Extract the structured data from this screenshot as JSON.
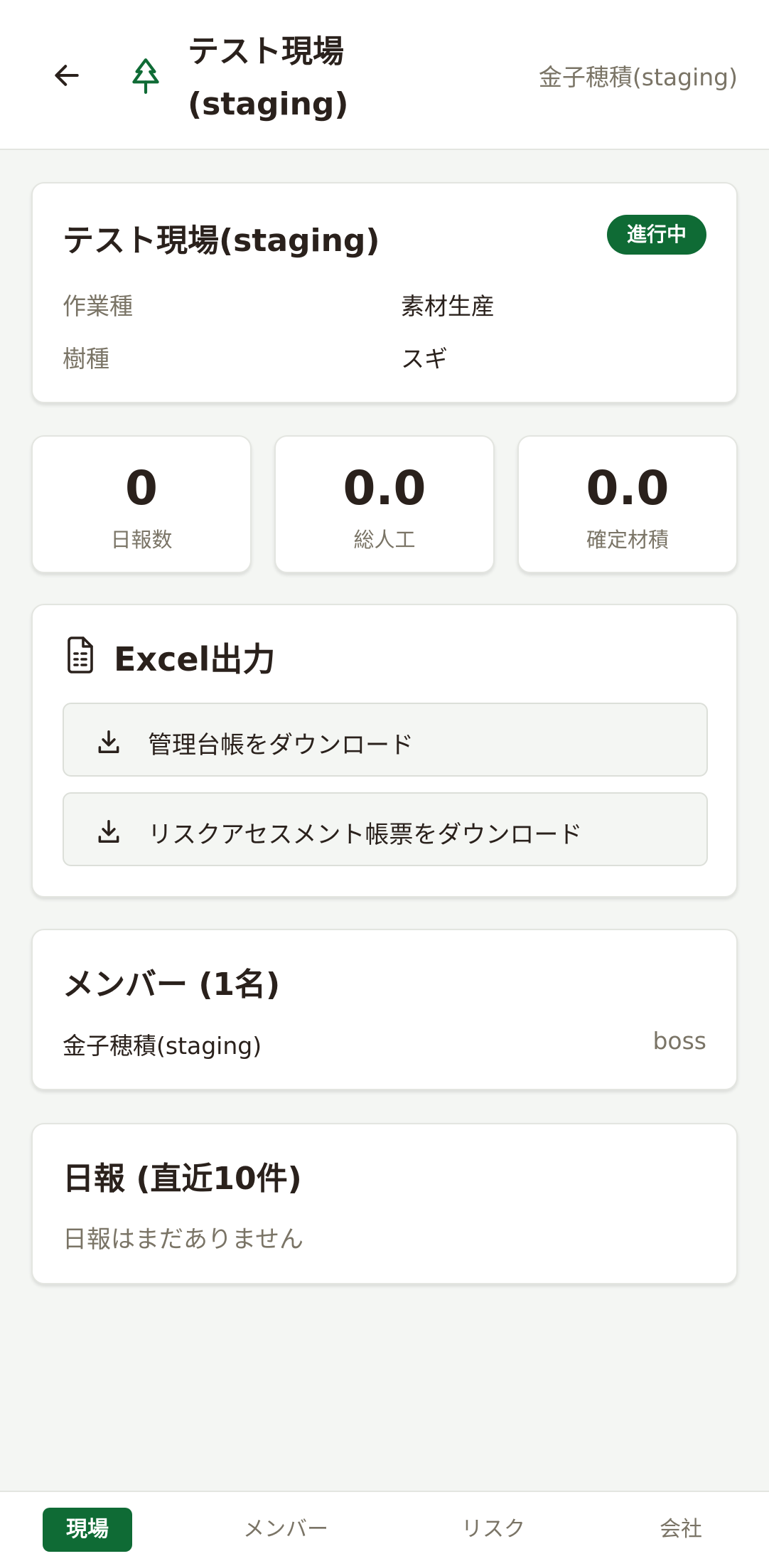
{
  "header": {
    "back_icon": "arrow-left-icon",
    "site_icon": "tree-icon",
    "title_line1": "テスト現場",
    "title_line2": "(staging)",
    "user_name": "金子穂積(staging)"
  },
  "site": {
    "name": "テスト現場(staging)",
    "status": "進行中",
    "status_color": "#0f6b35",
    "fields": [
      {
        "label": "作業種",
        "value": "素材生産"
      },
      {
        "label": "樹種",
        "value": "スギ"
      }
    ]
  },
  "stats": [
    {
      "value": "0",
      "label": "日報数"
    },
    {
      "value": "0.0",
      "label": "総人工"
    },
    {
      "value": "0.0",
      "label": "確定材積"
    }
  ],
  "excel": {
    "icon": "spreadsheet-file-icon",
    "title": "Excel出力",
    "buttons": [
      {
        "icon": "download-icon",
        "label": "管理台帳をダウンロード"
      },
      {
        "icon": "download-icon",
        "label": "リスクアセスメント帳票をダウンロード"
      }
    ]
  },
  "members": {
    "title": "メンバー (1名)",
    "items": [
      {
        "name": "金子穂積(staging)",
        "role": "boss"
      }
    ]
  },
  "reports": {
    "title": "日報 (直近10件)",
    "empty_text": "日報はまだありません"
  },
  "bottom_nav": {
    "items": [
      {
        "label": "現場",
        "active": true
      },
      {
        "label": "メンバー",
        "active": false
      },
      {
        "label": "リスク",
        "active": false
      },
      {
        "label": "会社",
        "active": false
      }
    ],
    "accent_color": "#0f6b35"
  }
}
